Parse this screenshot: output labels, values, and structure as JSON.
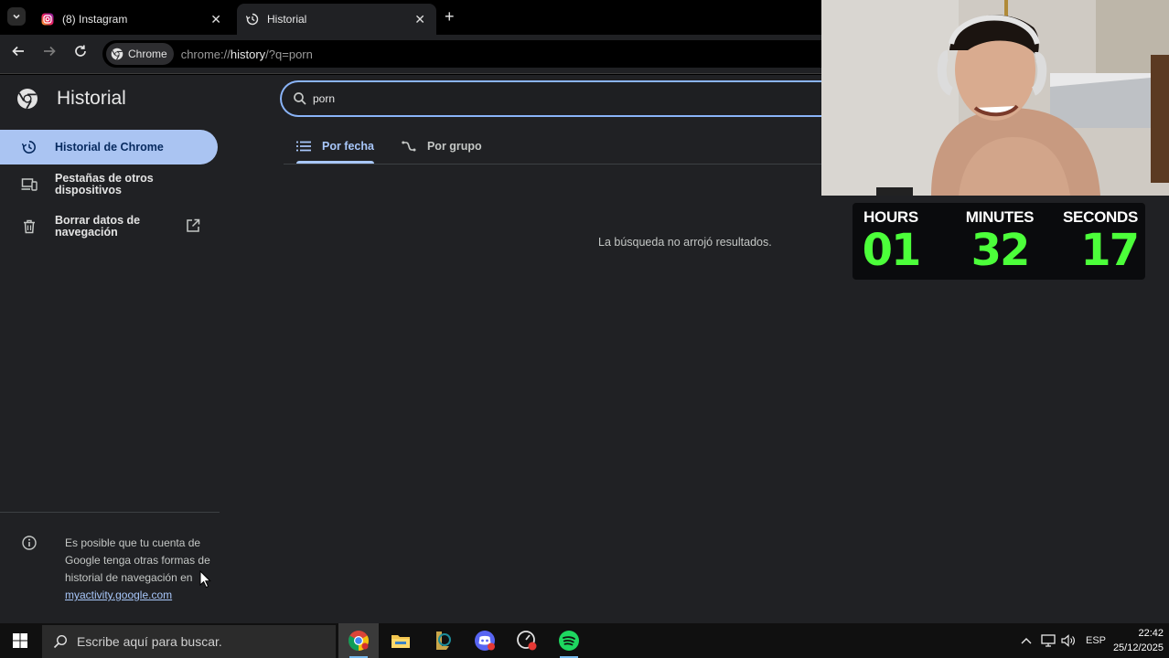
{
  "tabs": [
    {
      "title": "(8) Instagram"
    },
    {
      "title": "Historial"
    }
  ],
  "toolbar": {
    "chip_label": "Chrome",
    "url_prefix": "chrome://",
    "url_host": "history",
    "url_suffix": "/?q=porn"
  },
  "page": {
    "title": "Historial",
    "search_value": "porn",
    "sidebar": [
      {
        "label": "Historial de Chrome"
      },
      {
        "label": "Pestañas de otros dispositivos"
      },
      {
        "label": "Borrar datos de navegación"
      }
    ],
    "view_tabs": [
      {
        "label": "Por fecha"
      },
      {
        "label": "Por grupo"
      }
    ],
    "no_results": "La búsqueda no arrojó resultados.",
    "info_text": "Es posible que tu cuenta de Google tenga otras formas de historial de navegación en",
    "info_link": "myactivity.google.com"
  },
  "timer": {
    "hours_label": "HOURS",
    "minutes_label": "MINUTES",
    "seconds_label": "SECONDS",
    "hours": "01",
    "minutes": "32",
    "seconds": "17",
    "digit_color": "#4cff3a"
  },
  "taskbar": {
    "search_placeholder": "Escribe aquí para buscar.",
    "language": "ESP",
    "time": "22:42",
    "date": "25/12/2025"
  },
  "colors": {
    "accent": "#a8c7fa",
    "page_bg": "#202124"
  }
}
